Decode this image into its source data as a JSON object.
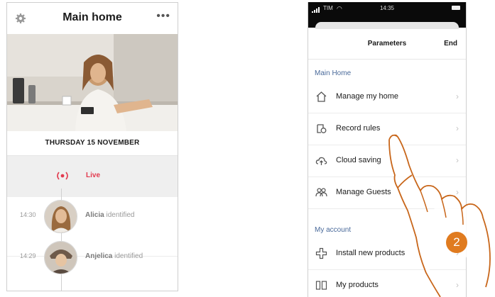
{
  "home_screen": {
    "title": "Main home",
    "date": "THURSDAY 15 NOVEMBER",
    "live_label": "Live",
    "events": [
      {
        "time": "14:30",
        "name": "Alicia",
        "status": "identified"
      },
      {
        "time": "14:29",
        "name": "Anjelica",
        "status": "identified"
      }
    ]
  },
  "parameters_screen": {
    "status_bar": {
      "carrier": "TIM",
      "time": "14:35"
    },
    "title": "Parameters",
    "end_label": "End",
    "main_home_section": "Main Home",
    "main_home_items": [
      {
        "label": "Manage my home",
        "icon": "house-icon"
      },
      {
        "label": "Record rules",
        "icon": "record-rules-icon"
      },
      {
        "label": "Cloud saving",
        "icon": "cloud-upload-icon"
      },
      {
        "label": "Manage Guests",
        "icon": "guests-icon"
      }
    ],
    "account_section": "My account",
    "account_items": [
      {
        "label": "Install new products",
        "icon": "plus-icon"
      },
      {
        "label": "My products",
        "icon": "products-icon"
      }
    ]
  },
  "step_badge": "2",
  "colors": {
    "live": "#e23a4e",
    "section": "#4a6a9a",
    "badge": "#e07b1f",
    "hand_outline": "#c8661a"
  }
}
